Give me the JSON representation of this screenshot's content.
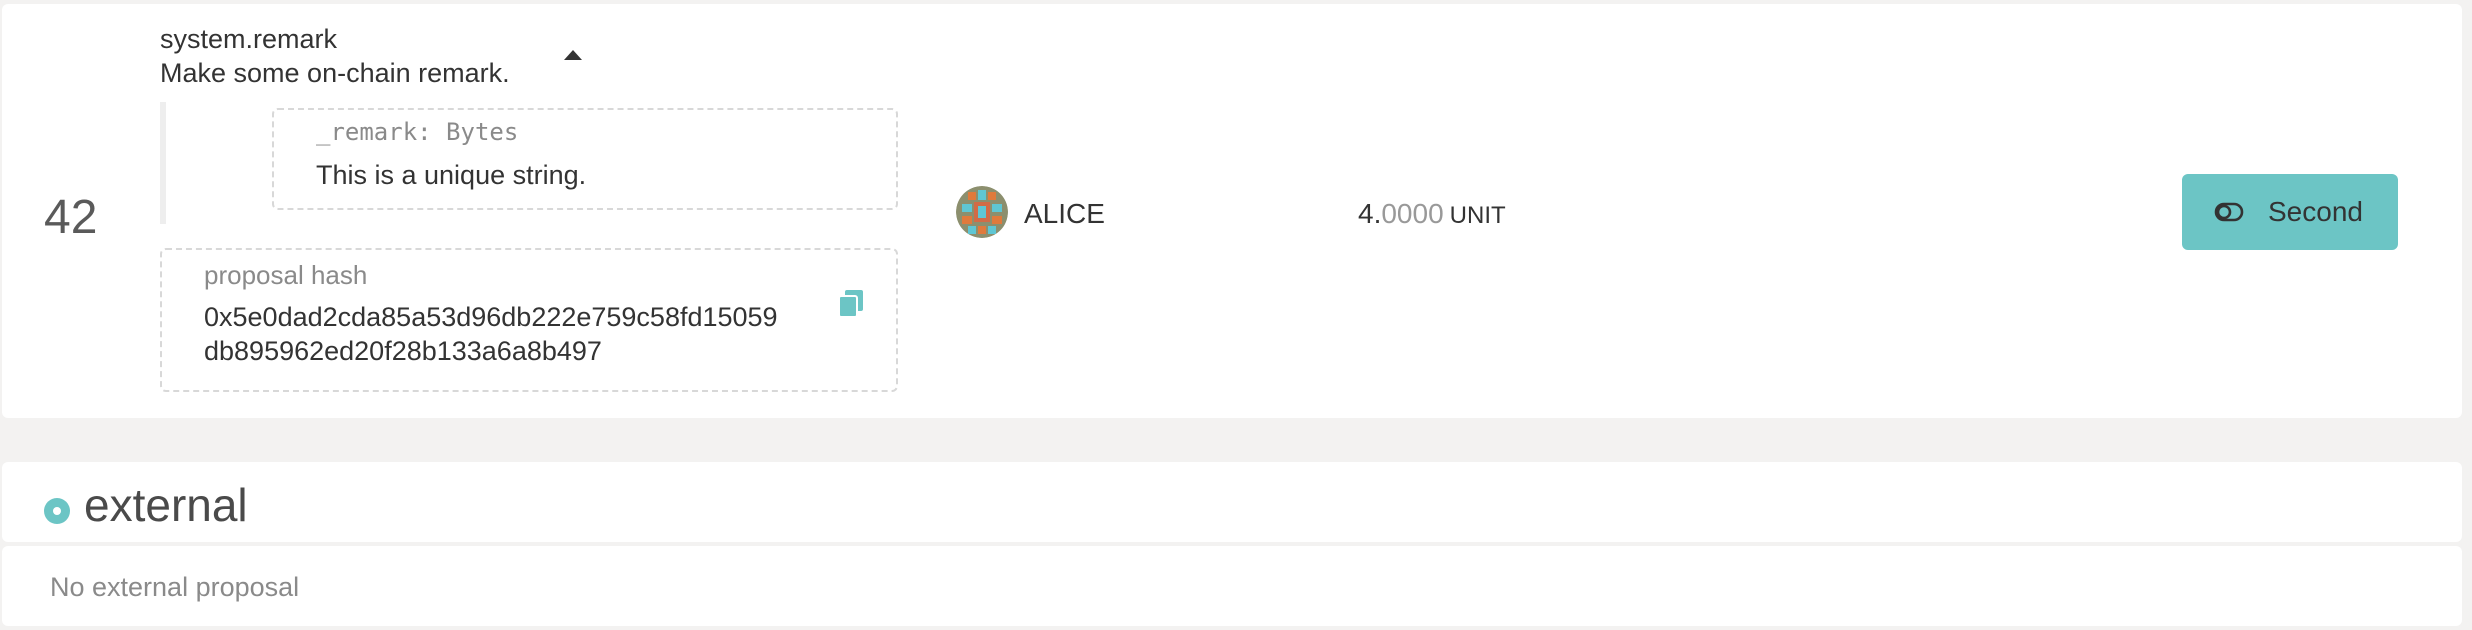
{
  "proposal": {
    "index": "42",
    "call_name": "system.remark",
    "call_doc": "Make some on-chain remark.",
    "param": {
      "label": "_remark: Bytes",
      "value": "This is a unique string."
    },
    "hash": {
      "label": "proposal hash",
      "line1": "0x5e0dad2cda85a53d96db222e759c58fd15059",
      "line2": "db895962ed20f28b133a6a8b497"
    },
    "proposer": {
      "name": "ALICE",
      "avatar_icon": "identicon-icon"
    },
    "deposit": {
      "integer": "4.",
      "decimals": "0000",
      "unit": "UNIT"
    },
    "second_button": {
      "label": "Second",
      "icon": "toggle-icon"
    }
  },
  "external": {
    "title": "external",
    "empty_text": "No external proposal"
  },
  "colors": {
    "accent": "#6cc5c5",
    "background": "#f3f2f1",
    "card": "#ffffff",
    "muted_text": "#8a8a8a"
  }
}
